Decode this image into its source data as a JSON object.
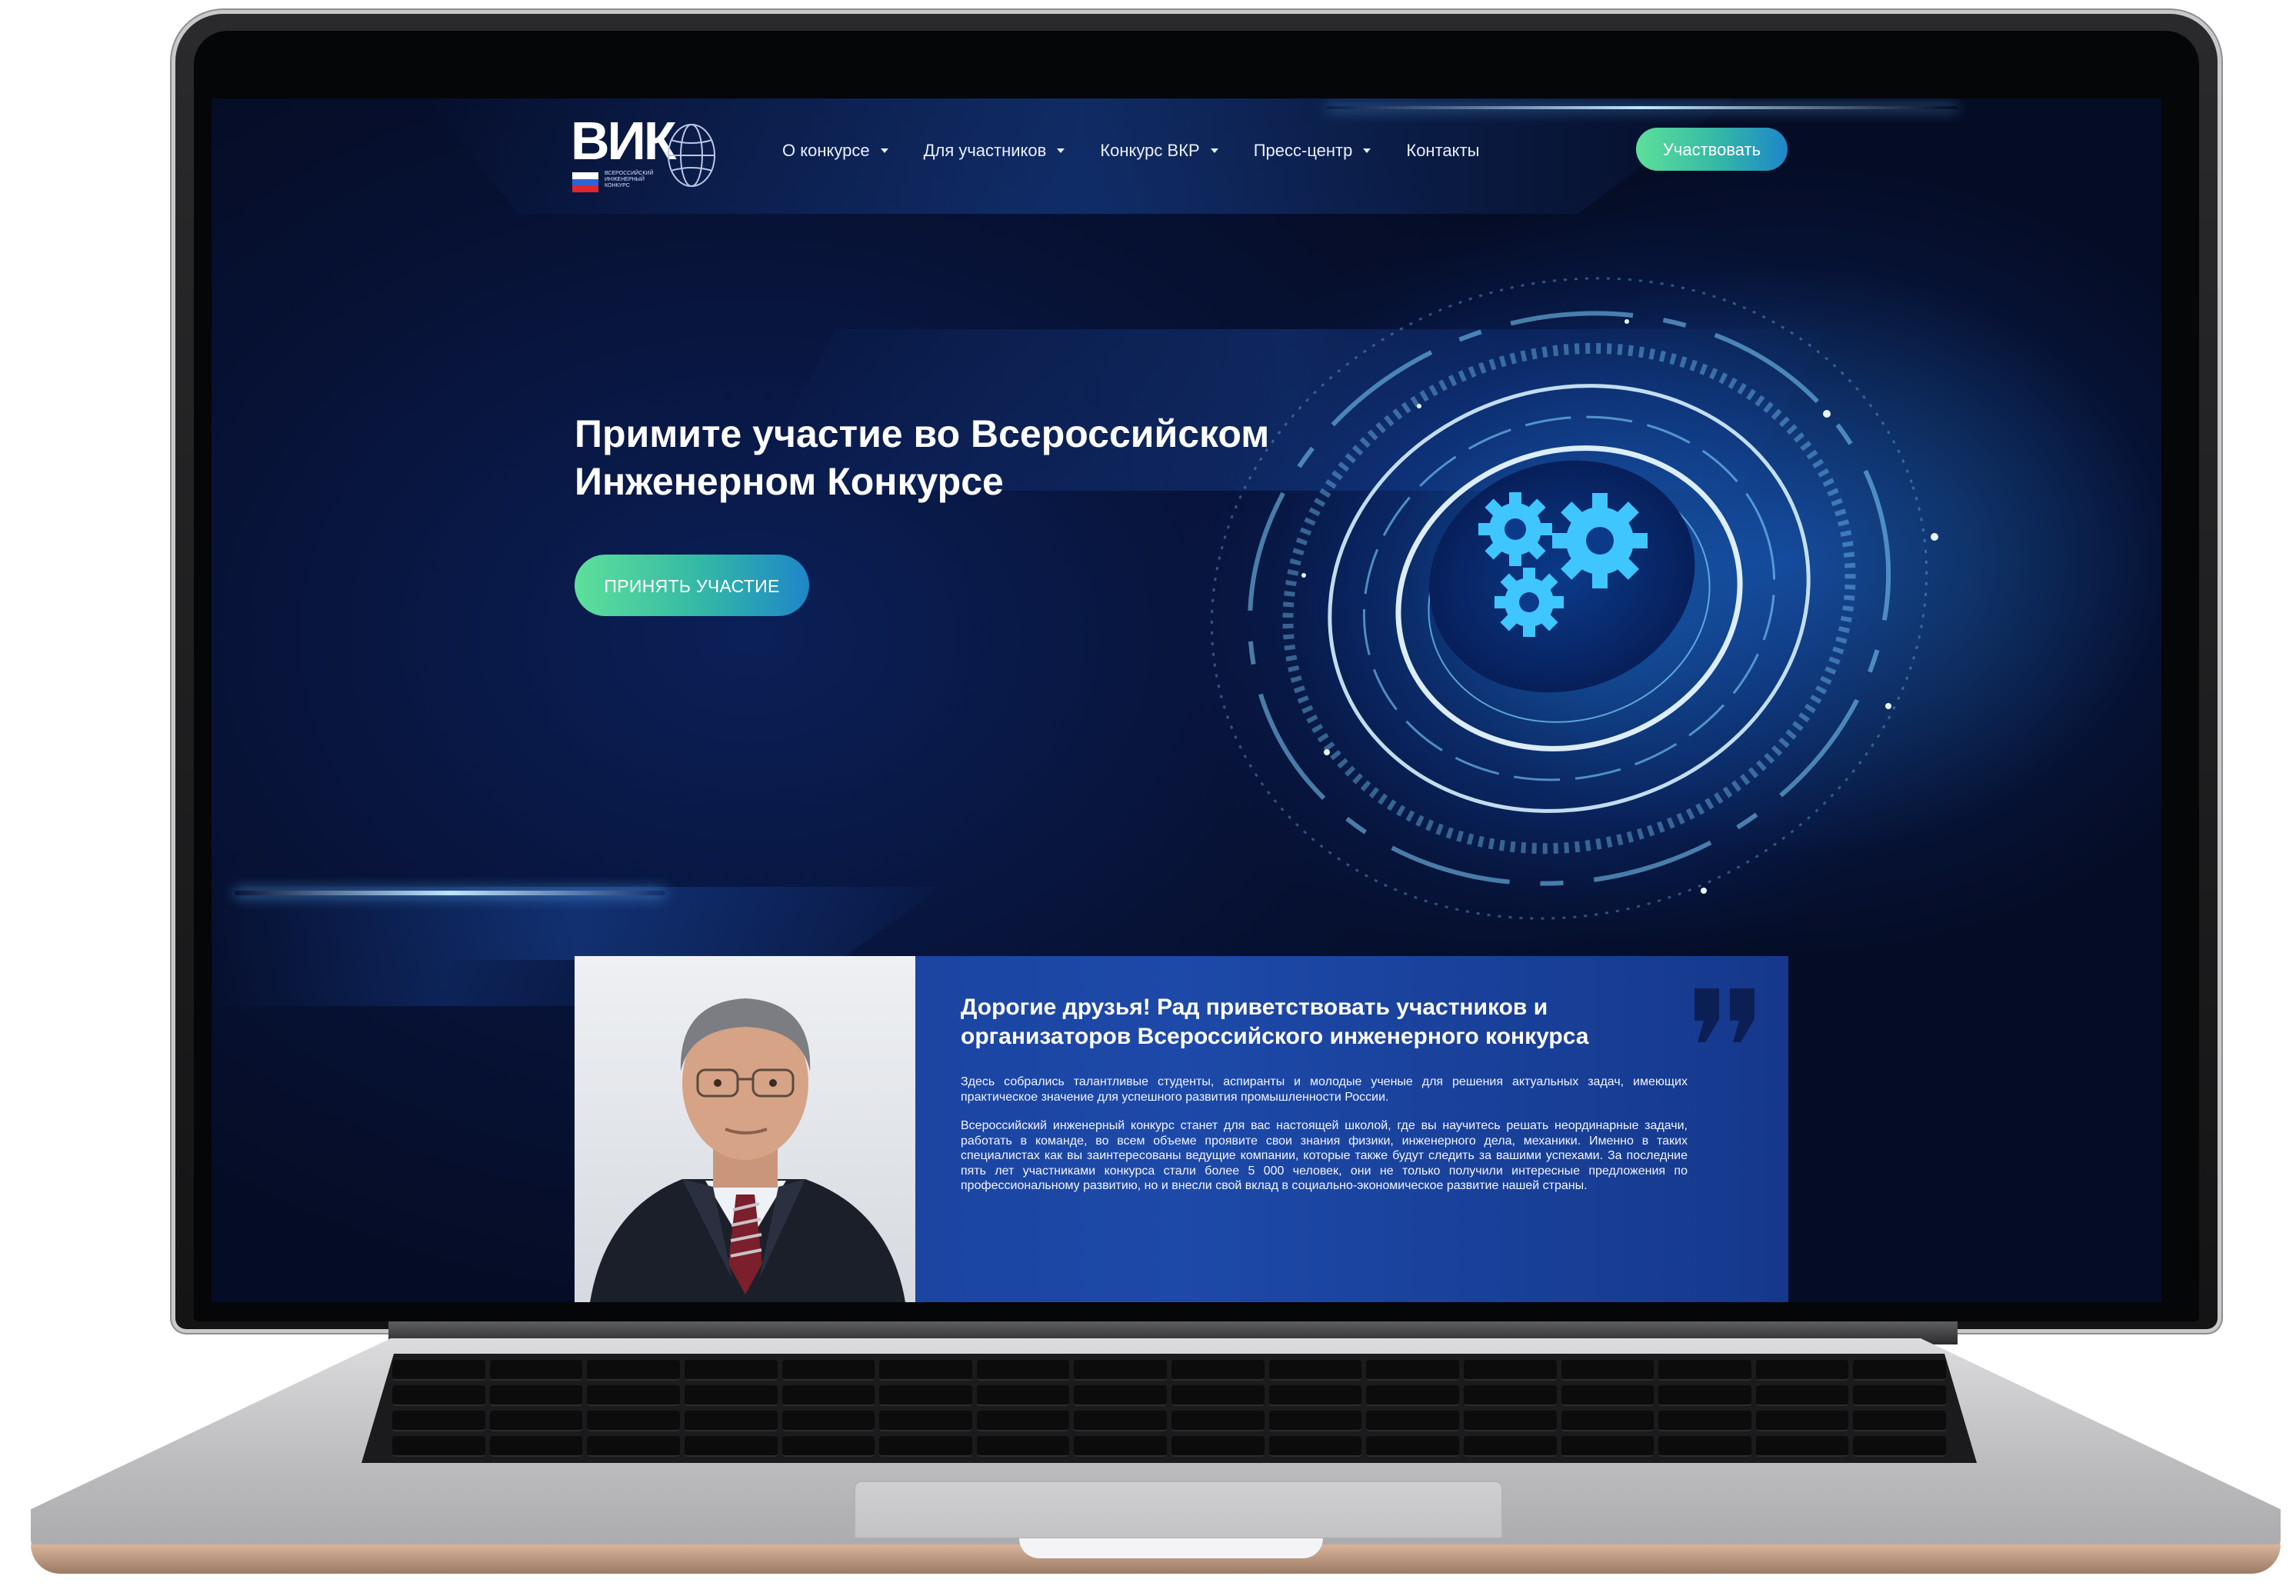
{
  "logo": {
    "wordmark": "ВИК",
    "subtitle": [
      "ВСЕРОССИЙСКИЙ",
      "ИНЖЕНЕРНЫЙ",
      "КОНКУРС"
    ]
  },
  "nav": {
    "items": [
      {
        "label": "О конкурсе"
      },
      {
        "label": "Для участников"
      },
      {
        "label": "Конкурс ВКР"
      },
      {
        "label": "Пресс-центр"
      },
      {
        "label": "Контакты"
      }
    ],
    "participate_label": "Участвовать"
  },
  "hero": {
    "title_line1": "Примите участие во Всероссийском",
    "title_line2": "Инженерном Конкурсе",
    "cta_label": "ПРИНЯТЬ УЧАСТИЕ"
  },
  "greeting": {
    "title_line1": "Дорогие друзья! Рад приветствовать участников и",
    "title_line2": "организаторов Всероссийского инженерного конкурса",
    "paragraph1": "Здесь собрались талантливые студенты, аспиранты и молодые ученые для решения актуальных задач, имеющих практическое значение для успешного развития промышленности России.",
    "paragraph2": "Всероссийский инженерный конкурс станет для вас настоящей школой, где вы научитесь решать неординарные задачи, работать в команде, во всем объеме проявите свои знания физики, инженерного дела, механики. Именно в таких специалистах как вы заинтересованы ведущие компании, которые также будут следить за вашими успехами. За последние пять лет участниками конкурса стали более 5 000 человек, они не только получили интересные предложения по профессиональному развитию, но и внесли свой вклад в социально-экономическое развитие нашей страны."
  },
  "colors": {
    "background": "#071236",
    "accent_green": "#5ee09a",
    "accent_blue": "#1e86c9",
    "card": "#1d49a8",
    "glow": "#4fc3ff"
  },
  "icons": {
    "dropdown": "caret-down-icon",
    "quote": "quote-marks-icon",
    "gears": "gears-icon",
    "globe": "globe-icon"
  }
}
